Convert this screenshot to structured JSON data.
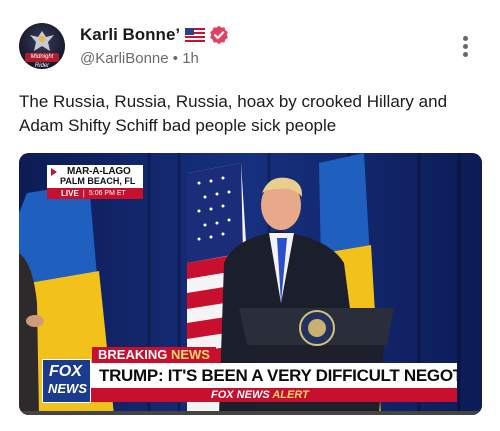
{
  "post": {
    "author_name": "Karli Bonne’",
    "handle": "@KarliBonne",
    "separator": "•",
    "age": "1h",
    "avatar_caption": "Midnight Rider",
    "text": "The Russia, Russia, Russia, hoax by crooked Hillary and Adam Shifty Schiff bad people sick people",
    "icons": {
      "flag": "us-flag-icon",
      "verified": "verified-badge-icon",
      "more": "more-options-icon"
    },
    "colors": {
      "verified": "#e4405f",
      "name": "#1a1a1a",
      "meta": "#6b6b6b"
    }
  },
  "video": {
    "location_line1": "MAR-A-LAGO",
    "location_line2": "PALM BEACH, FL",
    "live_label": "LIVE",
    "live_time": "5:06 PM ET",
    "breaking_word": "BREAKING",
    "breaking_news_word": "NEWS",
    "headline": "TRUMP: IT'S BEEN A VERY DIFFICULT NEGOTIATION",
    "logo_line1": "FOX",
    "logo_line2": "NEWS",
    "alert_brand": "FOX NEWS",
    "alert_word": "ALERT",
    "progress_fraction": 0.0,
    "colors": {
      "fox_red": "#c8102e",
      "fox_blue": "#1b3b8c",
      "highlight_yellow": "#ffd86b",
      "background_blue": "#0f1e5a"
    }
  }
}
